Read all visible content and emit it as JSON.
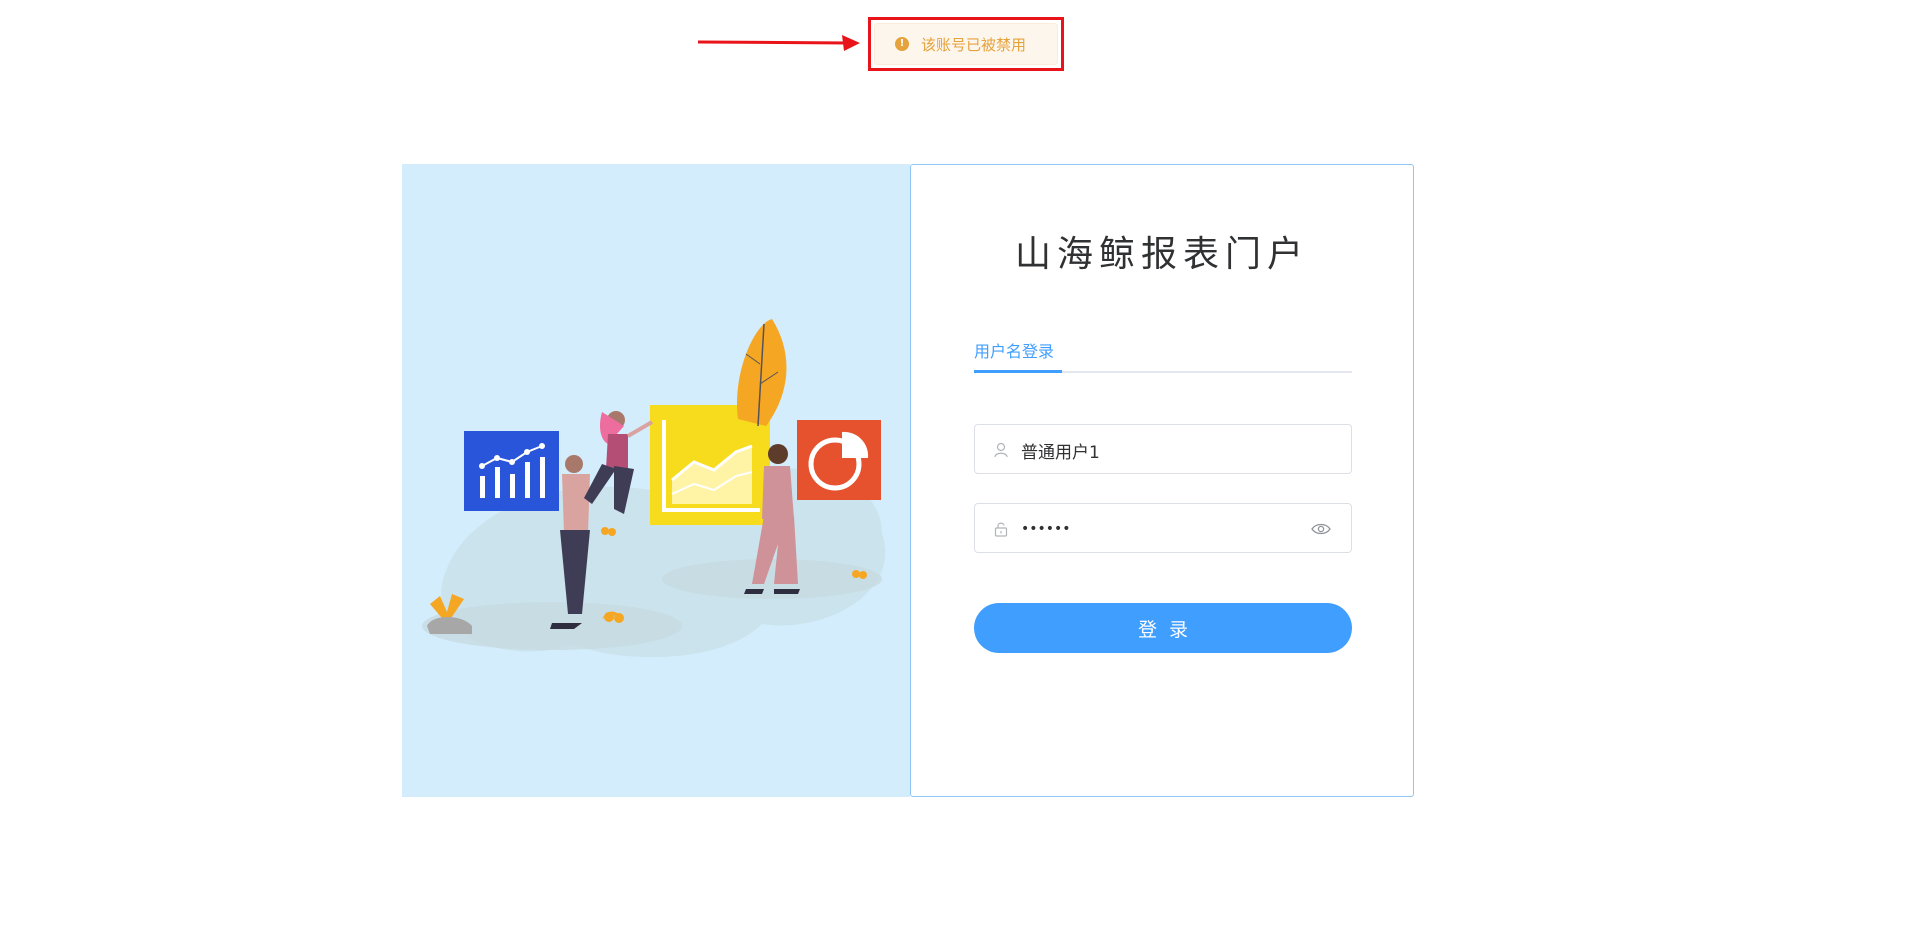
{
  "toast": {
    "icon": "exclamation-circle-icon",
    "message": "该账号已被禁用",
    "color": "#e6a23c"
  },
  "annotation": {
    "color": "#e8141a"
  },
  "login": {
    "title": "山海鲸报表门户",
    "tab_label": "用户名登录",
    "username": {
      "value": "普通用户1",
      "icon": "user-icon"
    },
    "password": {
      "value": "••••••",
      "icon": "lock-icon",
      "toggle_icon": "eye-icon"
    },
    "submit_label": "登录"
  },
  "colors": {
    "primary": "#409eff",
    "illustration_bg": "#d4edfc"
  }
}
